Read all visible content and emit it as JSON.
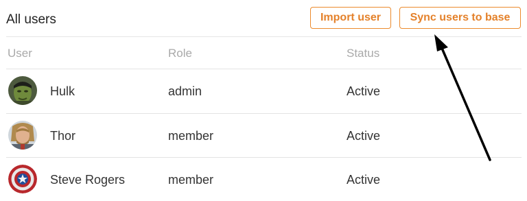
{
  "header": {
    "title": "All users",
    "import_label": "Import user",
    "sync_label": "Sync users to base"
  },
  "columns": {
    "user": "User",
    "role": "Role",
    "status": "Status"
  },
  "users": [
    {
      "name": "Hulk",
      "role": "admin",
      "status": "Active",
      "avatar_icon": "hulk-avatar"
    },
    {
      "name": "Thor",
      "role": "member",
      "status": "Active",
      "avatar_icon": "thor-avatar"
    },
    {
      "name": "Steve Rogers",
      "role": "member",
      "status": "Active",
      "avatar_icon": "captain-shield-avatar"
    }
  ],
  "colors": {
    "accent": "#e4812a",
    "divider": "#e3e3e3",
    "muted_text": "#a9a9a9",
    "annotation_arrow": "#000000"
  }
}
